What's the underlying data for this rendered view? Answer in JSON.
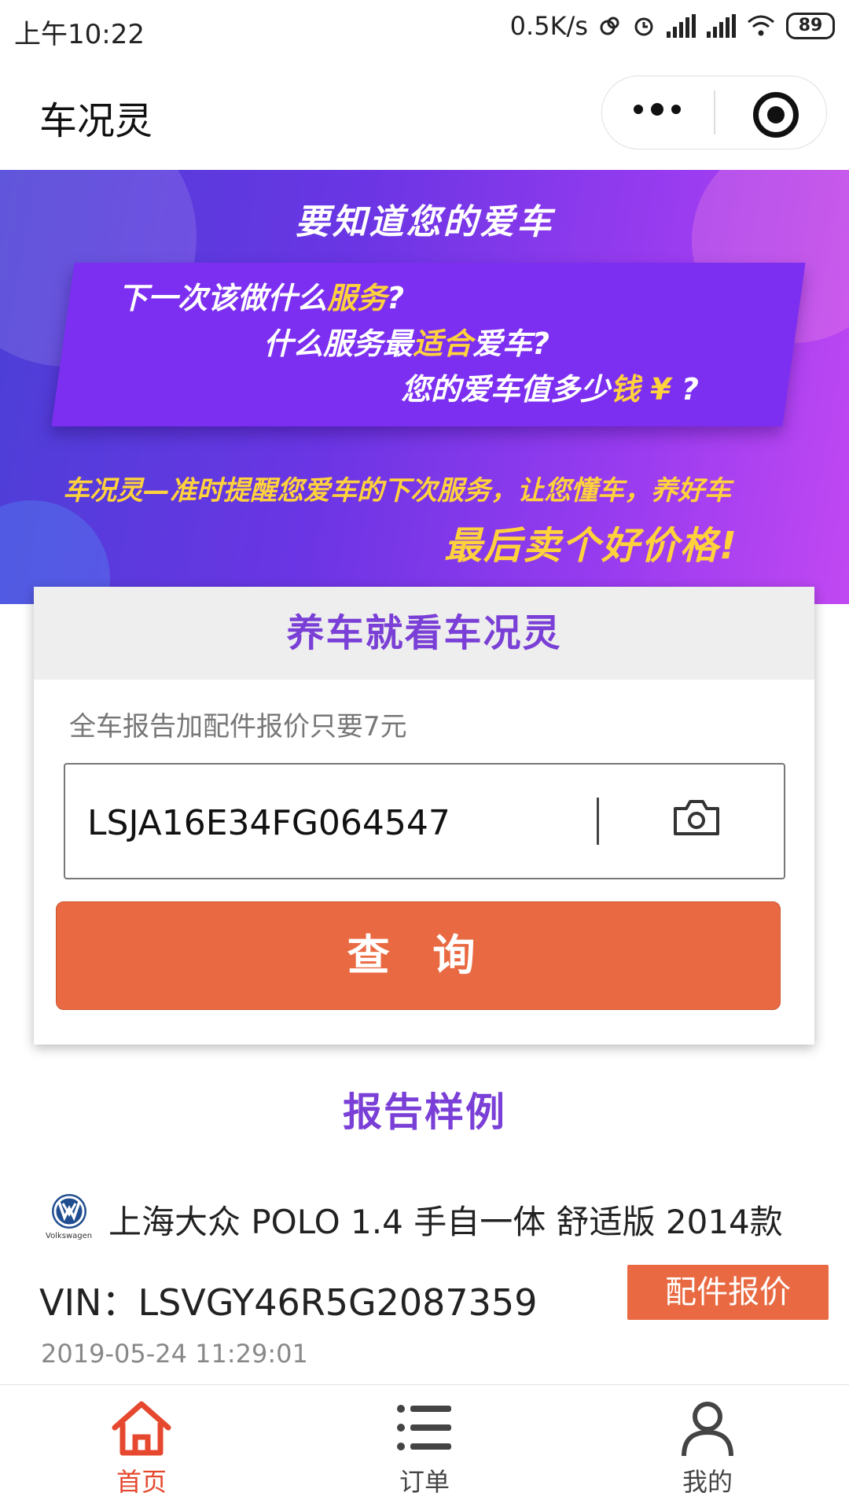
{
  "status_bar": {
    "time": "上午10:22",
    "speed": "0.5K/s",
    "battery": "89"
  },
  "nav": {
    "title": "车况灵"
  },
  "banner": {
    "headline": "要知道您的爱车",
    "line1": {
      "pre": "下一次该做什么",
      "hl": "服务",
      "post": "?"
    },
    "line2": {
      "pre": "什么服务最",
      "hl": "适合",
      "post": "爱车?"
    },
    "line3": {
      "pre": "您的爱车值多少",
      "hl": "钱 ¥",
      "post": " ?"
    },
    "slogan_1": "车况灵—准时提醒您爱车的下次服务，让您懂车，养好车",
    "slogan_2": "最后卖个好价格!",
    "accent_color": "#ffd23c"
  },
  "query_card": {
    "title": "养车就看车况灵",
    "subtitle": "全车报告加配件报价只要7元",
    "vin_value": "LSJA16E34FG064547",
    "camera_icon": "camera-icon",
    "query_button": "查 询",
    "button_color": "#e96a42"
  },
  "sample": {
    "section_title": "报告样例",
    "brand_icon": "volkswagen-logo",
    "brand_caption": "Volkswagen",
    "car_model": "上海大众 POLO 1.4 手自一体 舒适版 2014款",
    "vin": "VIN：LSVGY46R5G2087359",
    "parts_button": "配件报价",
    "date": "2019-05-24 11:29:01"
  },
  "tabbar": {
    "tabs": [
      {
        "label": "首页",
        "icon": "home-icon",
        "active": true
      },
      {
        "label": "订单",
        "icon": "list-icon",
        "active": false
      },
      {
        "label": "我的",
        "icon": "user-icon",
        "active": false
      }
    ],
    "active_color": "#e5482f"
  }
}
